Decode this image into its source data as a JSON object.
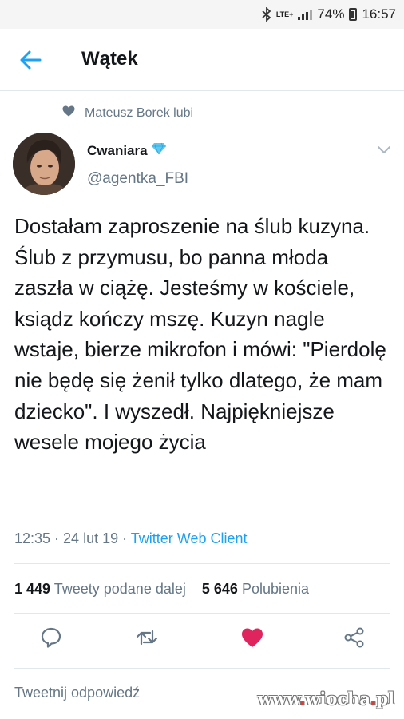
{
  "status_bar": {
    "network": "LTE+",
    "battery": "74%",
    "time": "16:57"
  },
  "header": {
    "title": "Wątek"
  },
  "social_context": {
    "text": "Mateusz Borek lubi"
  },
  "tweet": {
    "display_name": "Cwaniara",
    "handle": "@agentka_FBI",
    "text": "Dostałam zaproszenie na ślub kuzyna. Ślub z przymusu, bo panna młoda zaszła w ciążę. Jesteśmy w kościele, ksiądz kończy mszę. Kuzyn nagle wstaje, bierze mikrofon i mówi: \"Pierdolę nie będę się żenił tylko dlatego, że mam dziecko\". I wyszedł. Najpiękniejsze wesele mojego życia",
    "time": "12:35",
    "date": "24 lut 19",
    "separator": " · ",
    "client": "Twitter Web Client",
    "retweet_count": "1 449",
    "retweet_label": "Tweety podane dalej",
    "like_count": "5 646",
    "like_label": "Polubienia"
  },
  "reply_box": {
    "placeholder": "Tweetnij odpowiedź"
  },
  "watermark": {
    "prefix": "www",
    "dot1": ".",
    "name": "wiocha",
    "dot2": ".",
    "tld": "pl"
  },
  "colors": {
    "accent": "#1da1f2",
    "like": "#e0245e",
    "muted": "#657786",
    "text": "#14171a"
  },
  "icons": [
    "bluetooth-icon",
    "signal-icon",
    "battery-icon",
    "back-arrow-icon",
    "heart-small-icon",
    "verified-diamond-icon",
    "chevron-down-icon",
    "reply-icon",
    "retweet-icon",
    "like-icon",
    "share-icon"
  ]
}
